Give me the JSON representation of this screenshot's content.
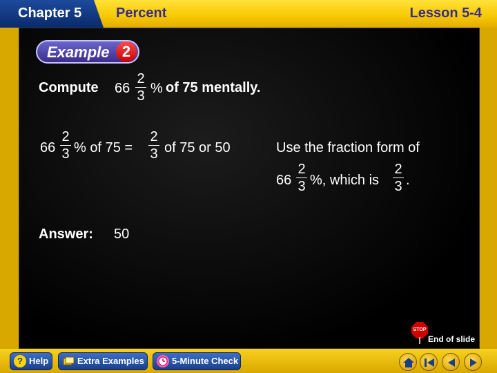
{
  "header": {
    "chapter": "Chapter 5",
    "section": "Percent",
    "lesson": "Lesson 5-4"
  },
  "badge": {
    "word": "Example",
    "number": "2"
  },
  "problem": {
    "lead": "Compute",
    "whole": "66",
    "num": "2",
    "den": "3",
    "pct": "%",
    "tail": "of 75 mentally."
  },
  "step": {
    "whole": "66",
    "num": "2",
    "den": "3",
    "pct_of": "% of 75 =",
    "num2": "2",
    "den2": "3",
    "tail": "of 75 or 50"
  },
  "note": {
    "line1": "Use the fraction form of",
    "whole": "66",
    "num": "2",
    "den": "3",
    "mid": "%, which is",
    "num2": "2",
    "den2": "3",
    "end": "."
  },
  "answer": {
    "label": "Answer:",
    "value": "50"
  },
  "end_of_slide": "End of slide",
  "stop_text": "STOP",
  "footer": {
    "help": "Help",
    "extra": "Extra Examples",
    "check": "5-Minute Check"
  },
  "icons": [
    "help-icon",
    "extra-examples-icon",
    "five-minute-check-icon",
    "home-icon",
    "first-slide-icon",
    "previous-slide-icon",
    "next-slide-icon"
  ],
  "colors": {
    "accent": "#f7c800",
    "board": "#000000",
    "button": "#1a3f8a"
  }
}
